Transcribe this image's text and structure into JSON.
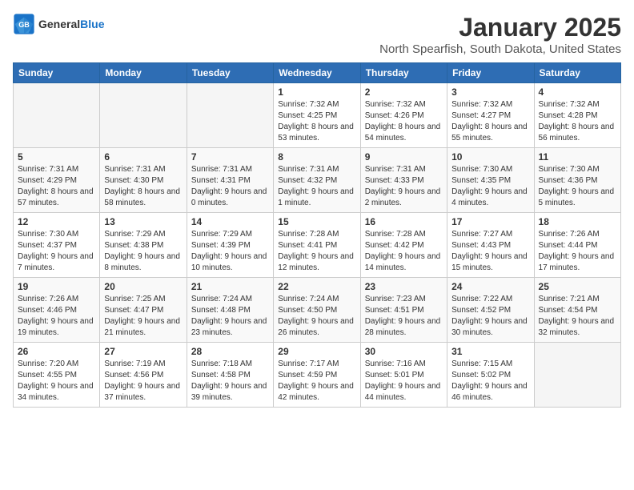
{
  "header": {
    "logo_line1": "General",
    "logo_line2": "Blue",
    "month_year": "January 2025",
    "location": "North Spearfish, South Dakota, United States"
  },
  "weekdays": [
    "Sunday",
    "Monday",
    "Tuesday",
    "Wednesday",
    "Thursday",
    "Friday",
    "Saturday"
  ],
  "weeks": [
    [
      {
        "day": "",
        "sunrise": "",
        "sunset": "",
        "daylight": ""
      },
      {
        "day": "",
        "sunrise": "",
        "sunset": "",
        "daylight": ""
      },
      {
        "day": "",
        "sunrise": "",
        "sunset": "",
        "daylight": ""
      },
      {
        "day": "1",
        "sunrise": "Sunrise: 7:32 AM",
        "sunset": "Sunset: 4:25 PM",
        "daylight": "Daylight: 8 hours and 53 minutes."
      },
      {
        "day": "2",
        "sunrise": "Sunrise: 7:32 AM",
        "sunset": "Sunset: 4:26 PM",
        "daylight": "Daylight: 8 hours and 54 minutes."
      },
      {
        "day": "3",
        "sunrise": "Sunrise: 7:32 AM",
        "sunset": "Sunset: 4:27 PM",
        "daylight": "Daylight: 8 hours and 55 minutes."
      },
      {
        "day": "4",
        "sunrise": "Sunrise: 7:32 AM",
        "sunset": "Sunset: 4:28 PM",
        "daylight": "Daylight: 8 hours and 56 minutes."
      }
    ],
    [
      {
        "day": "5",
        "sunrise": "Sunrise: 7:31 AM",
        "sunset": "Sunset: 4:29 PM",
        "daylight": "Daylight: 8 hours and 57 minutes."
      },
      {
        "day": "6",
        "sunrise": "Sunrise: 7:31 AM",
        "sunset": "Sunset: 4:30 PM",
        "daylight": "Daylight: 8 hours and 58 minutes."
      },
      {
        "day": "7",
        "sunrise": "Sunrise: 7:31 AM",
        "sunset": "Sunset: 4:31 PM",
        "daylight": "Daylight: 9 hours and 0 minutes."
      },
      {
        "day": "8",
        "sunrise": "Sunrise: 7:31 AM",
        "sunset": "Sunset: 4:32 PM",
        "daylight": "Daylight: 9 hours and 1 minute."
      },
      {
        "day": "9",
        "sunrise": "Sunrise: 7:31 AM",
        "sunset": "Sunset: 4:33 PM",
        "daylight": "Daylight: 9 hours and 2 minutes."
      },
      {
        "day": "10",
        "sunrise": "Sunrise: 7:30 AM",
        "sunset": "Sunset: 4:35 PM",
        "daylight": "Daylight: 9 hours and 4 minutes."
      },
      {
        "day": "11",
        "sunrise": "Sunrise: 7:30 AM",
        "sunset": "Sunset: 4:36 PM",
        "daylight": "Daylight: 9 hours and 5 minutes."
      }
    ],
    [
      {
        "day": "12",
        "sunrise": "Sunrise: 7:30 AM",
        "sunset": "Sunset: 4:37 PM",
        "daylight": "Daylight: 9 hours and 7 minutes."
      },
      {
        "day": "13",
        "sunrise": "Sunrise: 7:29 AM",
        "sunset": "Sunset: 4:38 PM",
        "daylight": "Daylight: 9 hours and 8 minutes."
      },
      {
        "day": "14",
        "sunrise": "Sunrise: 7:29 AM",
        "sunset": "Sunset: 4:39 PM",
        "daylight": "Daylight: 9 hours and 10 minutes."
      },
      {
        "day": "15",
        "sunrise": "Sunrise: 7:28 AM",
        "sunset": "Sunset: 4:41 PM",
        "daylight": "Daylight: 9 hours and 12 minutes."
      },
      {
        "day": "16",
        "sunrise": "Sunrise: 7:28 AM",
        "sunset": "Sunset: 4:42 PM",
        "daylight": "Daylight: 9 hours and 14 minutes."
      },
      {
        "day": "17",
        "sunrise": "Sunrise: 7:27 AM",
        "sunset": "Sunset: 4:43 PM",
        "daylight": "Daylight: 9 hours and 15 minutes."
      },
      {
        "day": "18",
        "sunrise": "Sunrise: 7:26 AM",
        "sunset": "Sunset: 4:44 PM",
        "daylight": "Daylight: 9 hours and 17 minutes."
      }
    ],
    [
      {
        "day": "19",
        "sunrise": "Sunrise: 7:26 AM",
        "sunset": "Sunset: 4:46 PM",
        "daylight": "Daylight: 9 hours and 19 minutes."
      },
      {
        "day": "20",
        "sunrise": "Sunrise: 7:25 AM",
        "sunset": "Sunset: 4:47 PM",
        "daylight": "Daylight: 9 hours and 21 minutes."
      },
      {
        "day": "21",
        "sunrise": "Sunrise: 7:24 AM",
        "sunset": "Sunset: 4:48 PM",
        "daylight": "Daylight: 9 hours and 23 minutes."
      },
      {
        "day": "22",
        "sunrise": "Sunrise: 7:24 AM",
        "sunset": "Sunset: 4:50 PM",
        "daylight": "Daylight: 9 hours and 26 minutes."
      },
      {
        "day": "23",
        "sunrise": "Sunrise: 7:23 AM",
        "sunset": "Sunset: 4:51 PM",
        "daylight": "Daylight: 9 hours and 28 minutes."
      },
      {
        "day": "24",
        "sunrise": "Sunrise: 7:22 AM",
        "sunset": "Sunset: 4:52 PM",
        "daylight": "Daylight: 9 hours and 30 minutes."
      },
      {
        "day": "25",
        "sunrise": "Sunrise: 7:21 AM",
        "sunset": "Sunset: 4:54 PM",
        "daylight": "Daylight: 9 hours and 32 minutes."
      }
    ],
    [
      {
        "day": "26",
        "sunrise": "Sunrise: 7:20 AM",
        "sunset": "Sunset: 4:55 PM",
        "daylight": "Daylight: 9 hours and 34 minutes."
      },
      {
        "day": "27",
        "sunrise": "Sunrise: 7:19 AM",
        "sunset": "Sunset: 4:56 PM",
        "daylight": "Daylight: 9 hours and 37 minutes."
      },
      {
        "day": "28",
        "sunrise": "Sunrise: 7:18 AM",
        "sunset": "Sunset: 4:58 PM",
        "daylight": "Daylight: 9 hours and 39 minutes."
      },
      {
        "day": "29",
        "sunrise": "Sunrise: 7:17 AM",
        "sunset": "Sunset: 4:59 PM",
        "daylight": "Daylight: 9 hours and 42 minutes."
      },
      {
        "day": "30",
        "sunrise": "Sunrise: 7:16 AM",
        "sunset": "Sunset: 5:01 PM",
        "daylight": "Daylight: 9 hours and 44 minutes."
      },
      {
        "day": "31",
        "sunrise": "Sunrise: 7:15 AM",
        "sunset": "Sunset: 5:02 PM",
        "daylight": "Daylight: 9 hours and 46 minutes."
      },
      {
        "day": "",
        "sunrise": "",
        "sunset": "",
        "daylight": ""
      }
    ]
  ]
}
